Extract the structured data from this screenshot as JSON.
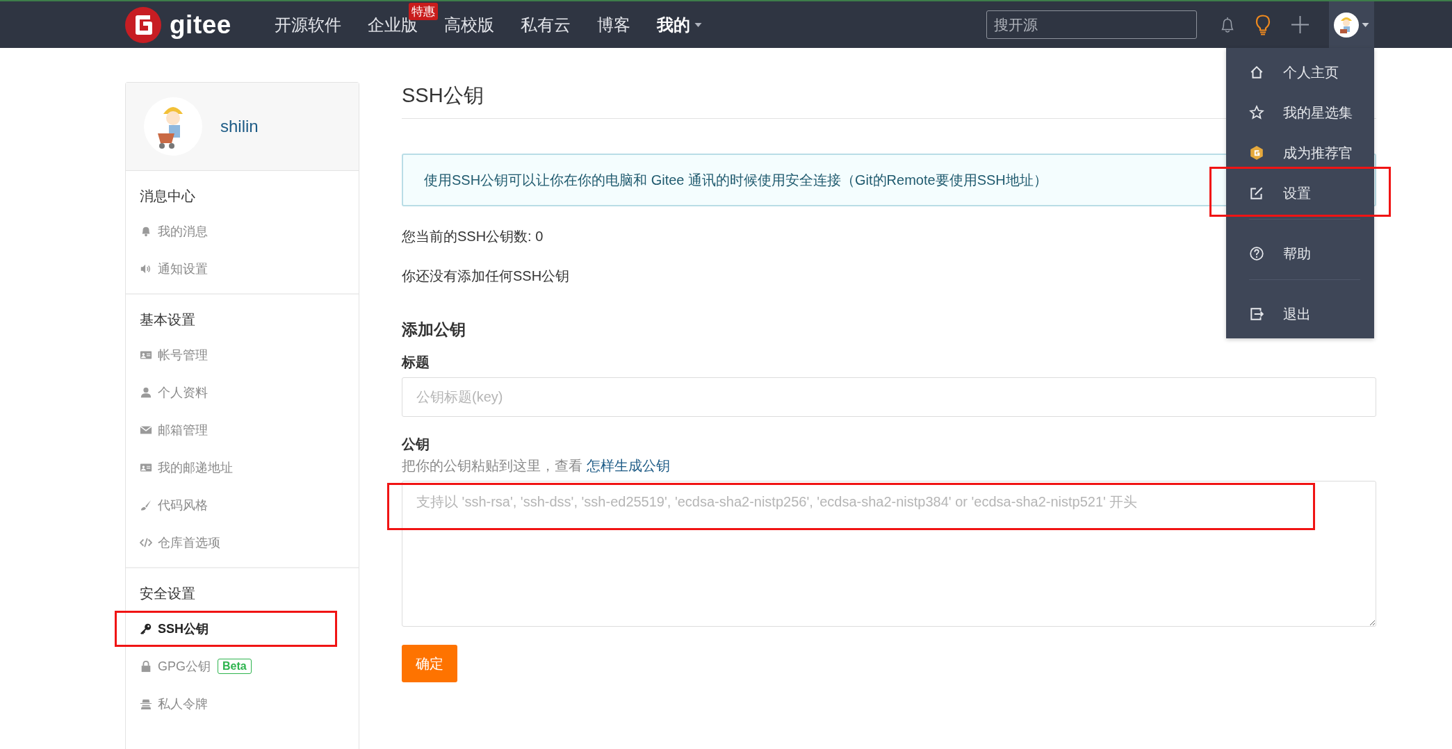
{
  "header": {
    "logo": "gitee",
    "nav": [
      {
        "label": "开源软件",
        "kind": "link"
      },
      {
        "label": "企业版",
        "kind": "link",
        "badge": "特惠"
      },
      {
        "label": "高校版",
        "kind": "link"
      },
      {
        "label": "私有云",
        "kind": "link"
      },
      {
        "label": "博客",
        "kind": "link"
      },
      {
        "label": "我的",
        "kind": "dropdown"
      }
    ],
    "search": {
      "placeholder": "搜开源"
    },
    "user_menu": {
      "expanded": true,
      "items": [
        {
          "label": "个人主页"
        },
        {
          "label": "我的星选集"
        },
        {
          "label": "成为推荐官"
        },
        {
          "label": "设置",
          "marked": true
        },
        {
          "label": "帮助"
        },
        {
          "label": "退出"
        }
      ]
    }
  },
  "sidebar": {
    "user": "shilin",
    "sections": [
      {
        "title": "消息中心",
        "items": [
          {
            "label": "我的消息",
            "selected": false
          },
          {
            "label": "通知设置",
            "selected": false
          }
        ]
      },
      {
        "title": "基本设置",
        "items": [
          {
            "label": "帐号管理",
            "selected": false
          },
          {
            "label": "个人资料",
            "selected": false
          },
          {
            "label": "邮箱管理",
            "selected": false
          },
          {
            "label": "我的邮递地址",
            "selected": false
          },
          {
            "label": "代码风格",
            "selected": false
          },
          {
            "label": "仓库首选项",
            "selected": false
          }
        ]
      },
      {
        "title": "安全设置",
        "items": [
          {
            "label": "SSH公钥",
            "selected": true,
            "marked": true
          },
          {
            "label": "GPG公钥",
            "selected": false,
            "badge": "Beta"
          },
          {
            "label": "私人令牌",
            "selected": false
          }
        ]
      }
    ]
  },
  "main": {
    "title": "SSH公钥",
    "notice": "使用SSH公钥可以让你在你的电脑和 Gitee 通讯的时候使用安全连接（Git的Remote要使用SSH地址）",
    "count": "您当前的SSH公钥数: 0",
    "empty": "你还没有添加任何SSH公钥",
    "form_title": "添加公钥",
    "title_label": "标题",
    "title_field": {
      "placeholder": "公钥标题(key)"
    },
    "key_label": "公钥",
    "key_hint": "把你的公钥粘贴到这里，查看 ",
    "key_hint_link": "怎样生成公钥",
    "key_field": {
      "placeholder": "支持以 'ssh-rsa', 'ssh-dss', 'ssh-ed25519', 'ecdsa-sha2-nistp256', 'ecdsa-sha2-nistp384' or 'ecdsa-sha2-nistp521' 开头",
      "marked": true
    },
    "submit": "确定"
  }
}
